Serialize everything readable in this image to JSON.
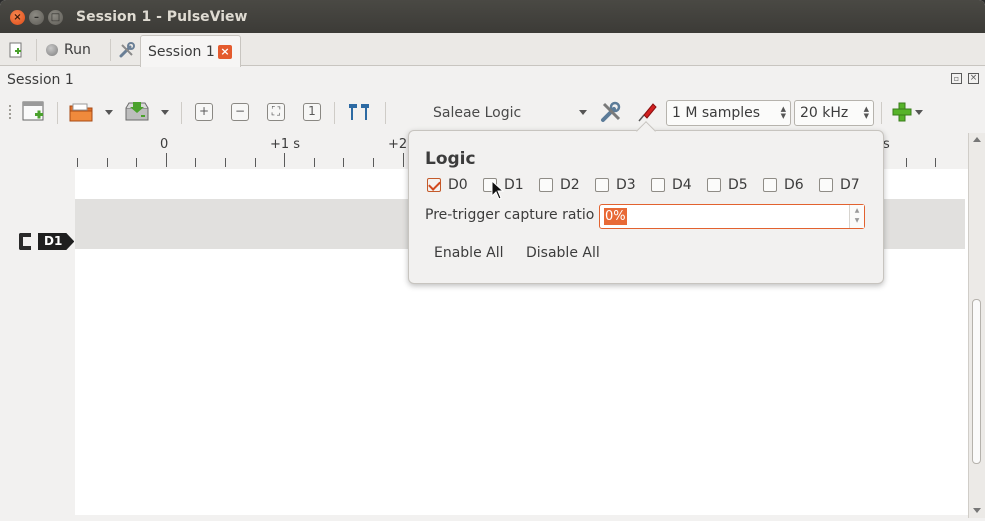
{
  "window": {
    "title": "Session 1 - PulseView"
  },
  "main_toolbar": {
    "run_label": "Run",
    "session_tab_label": "Session 1"
  },
  "dock": {
    "title": "Session 1"
  },
  "session_toolbar": {
    "device": "Saleae Logic",
    "sample_count": "1 M samples",
    "sample_rate": "20 kHz"
  },
  "ruler": {
    "labels": [
      "0",
      "+1 s",
      "+2",
      "s"
    ]
  },
  "trace": {
    "channel_label": "D1"
  },
  "popup": {
    "title": "Logic",
    "channels": [
      {
        "label": "D0",
        "checked": true
      },
      {
        "label": "D1",
        "checked": false
      },
      {
        "label": "D2",
        "checked": false
      },
      {
        "label": "D3",
        "checked": false
      },
      {
        "label": "D4",
        "checked": false
      },
      {
        "label": "D5",
        "checked": false
      },
      {
        "label": "D6",
        "checked": false
      },
      {
        "label": "D7",
        "checked": false
      }
    ],
    "pretrigger_label": "Pre-trigger capture ratio",
    "pretrigger_value": "0%",
    "enable_all_label": "Enable All",
    "disable_all_label": "Disable All"
  },
  "colors": {
    "accent": "#e86a36",
    "titlebar": "#3c3b37"
  },
  "icons": [
    "close-icon",
    "minimize-icon",
    "maximize-icon",
    "new-session-icon",
    "run-icon",
    "settings-icon",
    "tab-close-icon",
    "open-icon",
    "save-icon",
    "zoom-in-icon",
    "zoom-out-icon",
    "zoom-fit-icon",
    "zoom-one-icon",
    "cursor-icon",
    "device-config-icon",
    "probe-icon",
    "add-decoder-icon"
  ]
}
